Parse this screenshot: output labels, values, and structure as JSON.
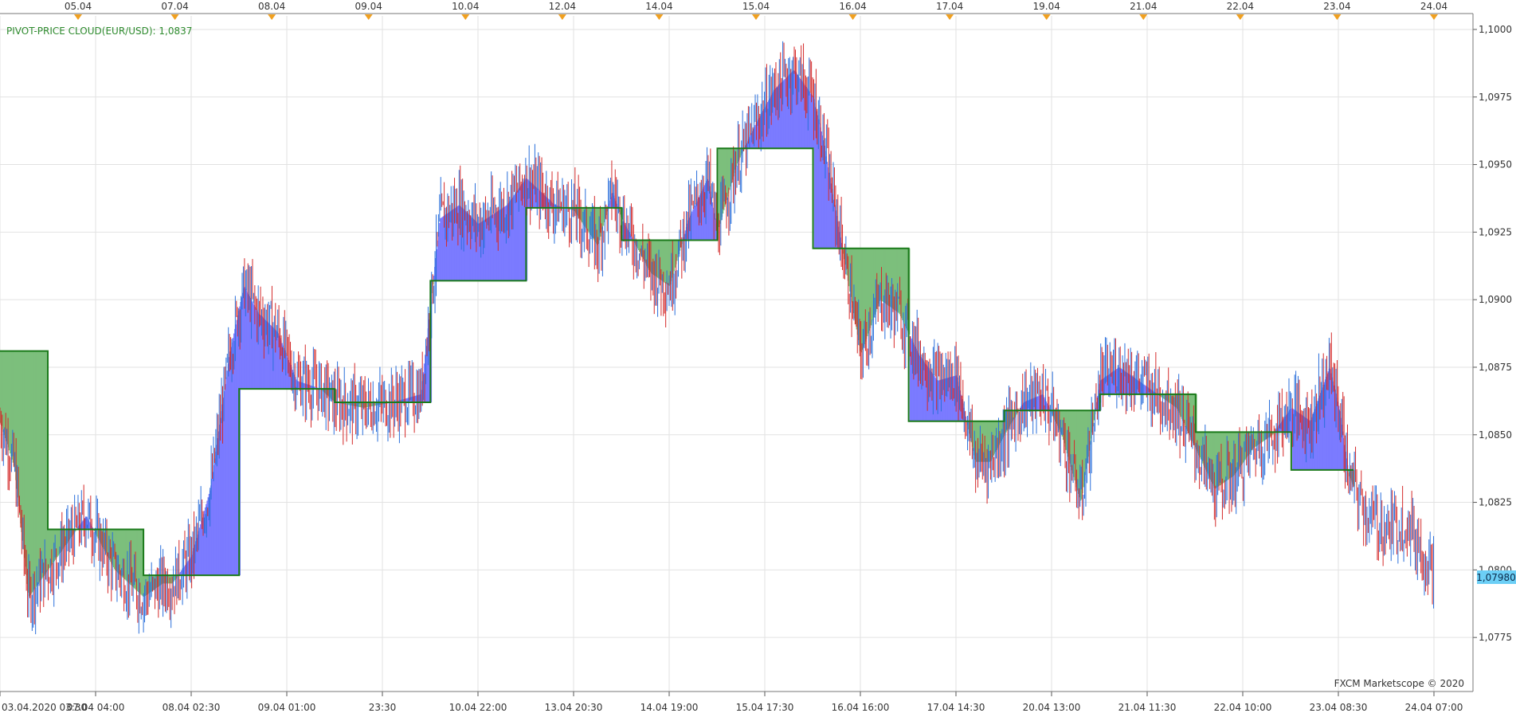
{
  "chart_data": {
    "type": "candlestick",
    "title": "PIVOT-PRICE CLOUD(EUR/USD): 1,0837",
    "credit": "FXCM Marketscope © 2020",
    "current_price": "1,07980",
    "ylim": [
      1.0755,
      1.1005
    ],
    "y_ticks": [
      "1,0775",
      "1,0800",
      "1,0825",
      "1,0850",
      "1,0875",
      "1,0900",
      "1,0925",
      "1,0950",
      "1,0975",
      "1,1000"
    ],
    "x_bottom_ticks": [
      "03.04.2020 03:30",
      "07.04 04:00",
      "08.04 02:30",
      "09.04 01:00",
      "23:30",
      "10.04 22:00",
      "13.04 20:30",
      "14.04 19:00",
      "15.04 17:30",
      "16.04 16:00",
      "17.04 14:30",
      "20.04 13:00",
      "21.04 11:30",
      "22.04 10:00",
      "23.04 08:30",
      "24.04 07:00"
    ],
    "x_top_ticks": [
      "05.04",
      "07.04",
      "08.04",
      "09.04",
      "10.04",
      "12.04",
      "14.04",
      "15.04",
      "16.04",
      "17.04",
      "19.04",
      "21.04",
      "22.04",
      "23.04",
      "24.04"
    ],
    "colors": {
      "pivot_line": "#1a7a1a",
      "cloud_below_price": "#7b7bff",
      "cloud_above_price": "#7cbf7c",
      "bull_candle": "#2a6fdb",
      "bear_candle": "#d42a2a",
      "grid": "#e2e2e2",
      "title": "#2e8b2e",
      "current_price_bg": "#6ccff6"
    },
    "pivot_levels": [
      {
        "x_from": 0,
        "x_to": 0.5,
        "value": 1.0881
      },
      {
        "x_from": 0.5,
        "x_to": 1.5,
        "value": 1.0815
      },
      {
        "x_from": 1.5,
        "x_to": 2.5,
        "value": 1.0798
      },
      {
        "x_from": 2.5,
        "x_to": 3.5,
        "value": 1.0867
      },
      {
        "x_from": 3.5,
        "x_to": 4.5,
        "value": 1.0862
      },
      {
        "x_from": 4.5,
        "x_to": 5.5,
        "value": 1.0907
      },
      {
        "x_from": 5.5,
        "x_to": 6.5,
        "value": 1.0934
      },
      {
        "x_from": 6.5,
        "x_to": 7.5,
        "value": 1.0922
      },
      {
        "x_from": 7.5,
        "x_to": 8.5,
        "value": 1.0956
      },
      {
        "x_from": 8.5,
        "x_to": 9.5,
        "value": 1.0919
      },
      {
        "x_from": 9.5,
        "x_to": 10.5,
        "value": 1.0855
      },
      {
        "x_from": 10.5,
        "x_to": 11.5,
        "value": 1.0859
      },
      {
        "x_from": 11.5,
        "x_to": 12.5,
        "value": 1.0865
      },
      {
        "x_from": 12.5,
        "x_to": 13.5,
        "value": 1.0851
      },
      {
        "x_from": 13.5,
        "x_to": 14.15,
        "value": 1.0837
      }
    ],
    "price_path": [
      [
        0,
        1.0855
      ],
      [
        0.15,
        1.0838
      ],
      [
        0.3,
        1.079
      ],
      [
        0.5,
        1.08
      ],
      [
        0.7,
        1.081
      ],
      [
        0.9,
        1.082
      ],
      [
        1.2,
        1.08
      ],
      [
        1.5,
        1.079
      ],
      [
        1.7,
        1.0795
      ],
      [
        1.8,
        1.0795
      ],
      [
        2.0,
        1.0805
      ],
      [
        2.2,
        1.083
      ],
      [
        2.4,
        1.088
      ],
      [
        2.55,
        1.0905
      ],
      [
        2.7,
        1.0895
      ],
      [
        2.9,
        1.0888
      ],
      [
        3.1,
        1.087
      ],
      [
        3.35,
        1.0867
      ],
      [
        3.5,
        1.0862
      ],
      [
        3.8,
        1.086
      ],
      [
        4.1,
        1.0862
      ],
      [
        4.4,
        1.0865
      ],
      [
        4.6,
        1.093
      ],
      [
        4.8,
        1.0935
      ],
      [
        5.0,
        1.0928
      ],
      [
        5.3,
        1.0935
      ],
      [
        5.5,
        1.0945
      ],
      [
        5.8,
        1.0935
      ],
      [
        6.0,
        1.0933
      ],
      [
        6.25,
        1.092
      ],
      [
        6.4,
        1.094
      ],
      [
        6.5,
        1.093
      ],
      [
        6.8,
        1.091
      ],
      [
        7.0,
        1.0905
      ],
      [
        7.2,
        1.093
      ],
      [
        7.4,
        1.0945
      ],
      [
        7.5,
        1.0925
      ],
      [
        7.7,
        1.095
      ],
      [
        7.9,
        1.0965
      ],
      [
        8.1,
        1.0978
      ],
      [
        8.3,
        1.0985
      ],
      [
        8.5,
        1.0975
      ],
      [
        8.6,
        1.096
      ],
      [
        8.8,
        1.092
      ],
      [
        9.0,
        1.088
      ],
      [
        9.2,
        1.09
      ],
      [
        9.4,
        1.0895
      ],
      [
        9.6,
        1.088
      ],
      [
        9.8,
        1.087
      ],
      [
        10.0,
        1.0872
      ],
      [
        10.2,
        1.084
      ],
      [
        10.35,
        1.084
      ],
      [
        10.5,
        1.085
      ],
      [
        10.7,
        1.0862
      ],
      [
        10.9,
        1.0865
      ],
      [
        11.1,
        1.085
      ],
      [
        11.3,
        1.0825
      ],
      [
        11.5,
        1.087
      ],
      [
        11.7,
        1.0875
      ],
      [
        11.9,
        1.087
      ],
      [
        12.1,
        1.0865
      ],
      [
        12.3,
        1.086
      ],
      [
        12.5,
        1.0845
      ],
      [
        12.7,
        1.083
      ],
      [
        12.9,
        1.0835
      ],
      [
        13.1,
        1.0845
      ],
      [
        13.3,
        1.085
      ],
      [
        13.5,
        1.086
      ],
      [
        13.7,
        1.0855
      ],
      [
        13.9,
        1.0875
      ],
      [
        14.0,
        1.086
      ],
      [
        14.1,
        1.0835
      ],
      [
        14.3,
        1.082
      ],
      [
        14.5,
        1.0815
      ],
      [
        14.7,
        1.0818
      ],
      [
        14.9,
        1.0805
      ],
      [
        15.0,
        1.08
      ]
    ]
  }
}
